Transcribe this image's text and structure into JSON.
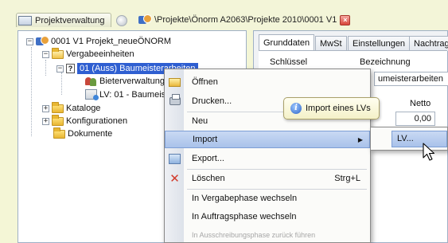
{
  "tabs": [
    {
      "label": "Projektverwaltung"
    },
    {
      "label": "\\Projekte\\Önorm A2063\\Projekte 2010\\0001 V1"
    }
  ],
  "tree": {
    "root": "0001 V1 Projekt_neueÖNORM",
    "vergabe": "Vergabeeinheiten",
    "selected_lv": "01 (Auss) Baumeisterarbeiten",
    "bieter": "Bieterverwaltung",
    "lv": "LV: 01 - Baumeis",
    "kataloge": "Kataloge",
    "konfig": "Konfigurationen",
    "dokumente": "Dokumente",
    "question_mark": "?",
    "collapse_sign": "−",
    "expand_sign": "+"
  },
  "right_panel": {
    "tabs": [
      "Grunddaten",
      "MwSt",
      "Einstellungen",
      "Nachtrag"
    ],
    "label_schluessel": "Schlüssel",
    "label_bezeichnung": "Bezeichnung",
    "bezeichnung_value": "umeisterarbeiten",
    "label_netto": "Netto",
    "netto_value": "0,00"
  },
  "context_menu": {
    "oeffnen": "Öffnen",
    "drucken": "Drucken...",
    "neu": "Neu",
    "import": "Import",
    "export": "Export...",
    "loeschen": "Löschen",
    "loeschen_shortcut": "Strg+L",
    "vergabephase": "In Vergabephase wechseln",
    "auftragsphase": "In Auftragsphase wechseln",
    "ausschreibung": "In Ausschreibungsphase zurück führen",
    "submenu_arrow": "▶",
    "delete_glyph": "✕"
  },
  "submenu": {
    "lv": "LV..."
  },
  "tooltip": {
    "text": "Import eines LVs",
    "info_glyph": "i"
  }
}
